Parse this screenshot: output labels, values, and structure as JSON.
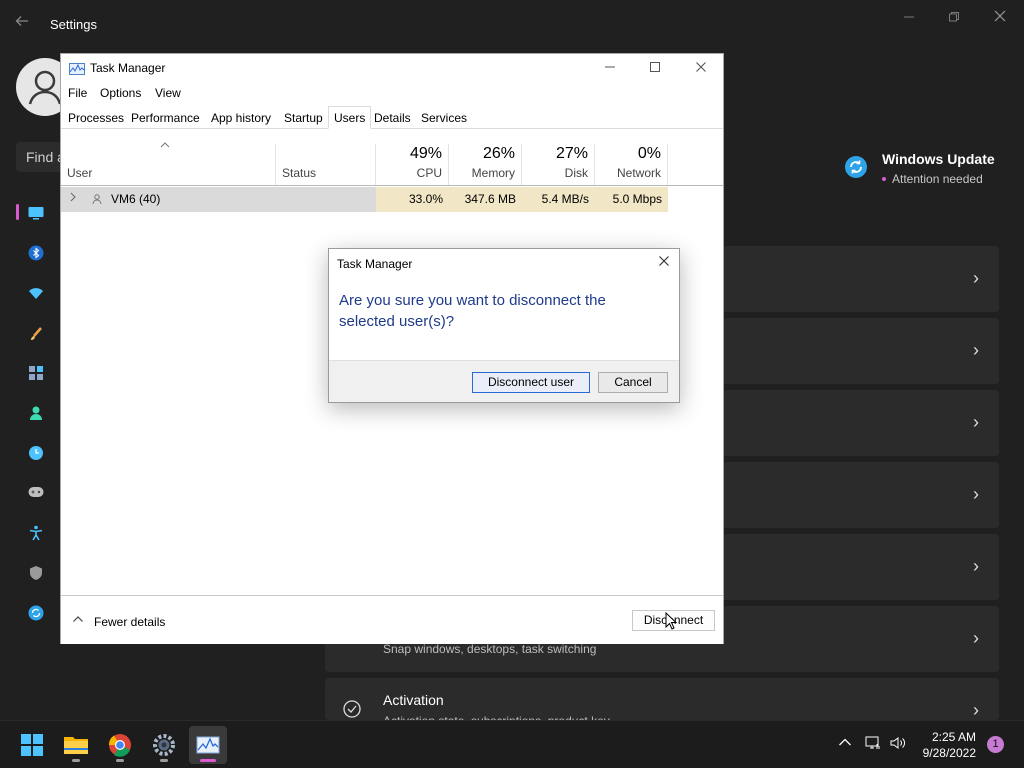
{
  "settings": {
    "title": "Settings",
    "search_placeholder": "Find a",
    "windows_update": {
      "title": "Windows Update",
      "status": "Attention needed"
    },
    "cards": [
      {
        "title": "",
        "subtitle": ""
      },
      {
        "title": "",
        "subtitle": ""
      },
      {
        "title": "",
        "subtitle": ""
      },
      {
        "title": "",
        "subtitle": ""
      },
      {
        "title": "",
        "subtitle": ""
      },
      {
        "title": "",
        "subtitle": "Snap windows, desktops, task switching"
      },
      {
        "title": "Activation",
        "subtitle": "Activation state, subscriptions, product key"
      }
    ],
    "sidebar_icons": [
      "system-icon",
      "bluetooth-icon",
      "network-icon",
      "personalization-icon",
      "apps-icon",
      "accounts-icon",
      "time-language-icon",
      "gaming-icon",
      "accessibility-icon",
      "privacy-security-icon",
      "windows-update-icon"
    ]
  },
  "task_manager": {
    "title": "Task Manager",
    "menu": [
      "File",
      "Options",
      "View"
    ],
    "tabs": [
      "Processes",
      "Performance",
      "App history",
      "Startup",
      "Users",
      "Details",
      "Services"
    ],
    "active_tab": "Users",
    "columns": {
      "user": "User",
      "status": "Status",
      "cpu": {
        "pct": "49%",
        "label": "CPU"
      },
      "memory": {
        "pct": "26%",
        "label": "Memory"
      },
      "disk": {
        "pct": "27%",
        "label": "Disk"
      },
      "network": {
        "pct": "0%",
        "label": "Network"
      }
    },
    "rows": [
      {
        "user": "VM6 (40)",
        "status": "",
        "cpu": "33.0%",
        "memory": "347.6 MB",
        "disk": "5.4 MB/s",
        "network": "5.0 Mbps"
      }
    ],
    "footer": {
      "fewer_details": "Fewer details",
      "disconnect": "Disconnect"
    }
  },
  "dialog": {
    "title": "Task Manager",
    "message": "Are you sure you want to disconnect the selected user(s)?",
    "confirm": "Disconnect user",
    "cancel": "Cancel"
  },
  "taskbar": {
    "apps": [
      "start-icon",
      "file-explorer-icon",
      "chrome-icon",
      "settings-icon",
      "task-manager-icon"
    ],
    "time": "2:25 AM",
    "date": "9/28/2022",
    "notification_count": "1"
  },
  "colors": {
    "accent": "#d95bd0",
    "dialog_text": "#1e3a8a",
    "metric_highlight": "#f1e6c6",
    "update_blue": "#2ea3e8"
  }
}
